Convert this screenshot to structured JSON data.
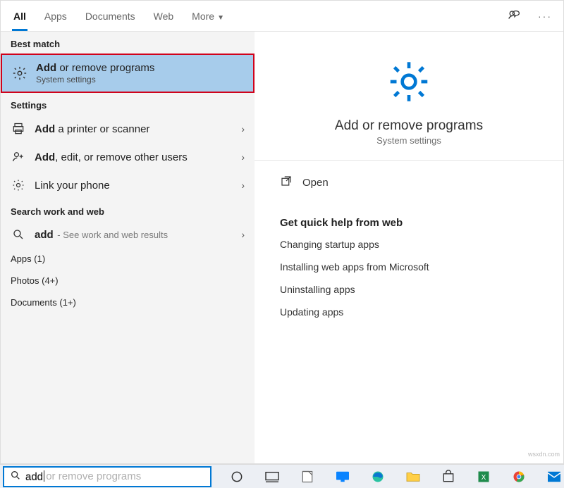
{
  "tabs": {
    "items": [
      "All",
      "Apps",
      "Documents",
      "Web",
      "More"
    ],
    "active": 0
  },
  "left": {
    "best_match_header": "Best match",
    "best_match": {
      "title_bold": "Add",
      "title_rest": " or remove programs",
      "subtitle": "System settings"
    },
    "settings_header": "Settings",
    "settings": [
      {
        "bold": "Add",
        "rest": " a printer or scanner",
        "icon": "printer-icon"
      },
      {
        "bold": "Add",
        "rest": ", edit, or remove other users",
        "icon": "user-plus-icon"
      },
      {
        "bold": "",
        "rest": "Link your phone",
        "icon": "gear-icon"
      }
    ],
    "search_web_header": "Search work and web",
    "search_web_row": {
      "bold": "add",
      "rest": " - See work and web results"
    },
    "categories": [
      {
        "label": "Apps",
        "count": "1"
      },
      {
        "label": "Photos",
        "count": "4+"
      },
      {
        "label": "Documents",
        "count": "1+"
      }
    ]
  },
  "right": {
    "hero_title": "Add or remove programs",
    "hero_sub": "System settings",
    "open_label": "Open",
    "quick_help_header": "Get quick help from web",
    "quick_help": [
      "Changing startup apps",
      "Installing web apps from Microsoft",
      "Uninstalling apps",
      "Updating apps"
    ]
  },
  "search": {
    "typed": "add",
    "placeholder": "add or remove programs"
  },
  "watermark": "wsxdn.com"
}
